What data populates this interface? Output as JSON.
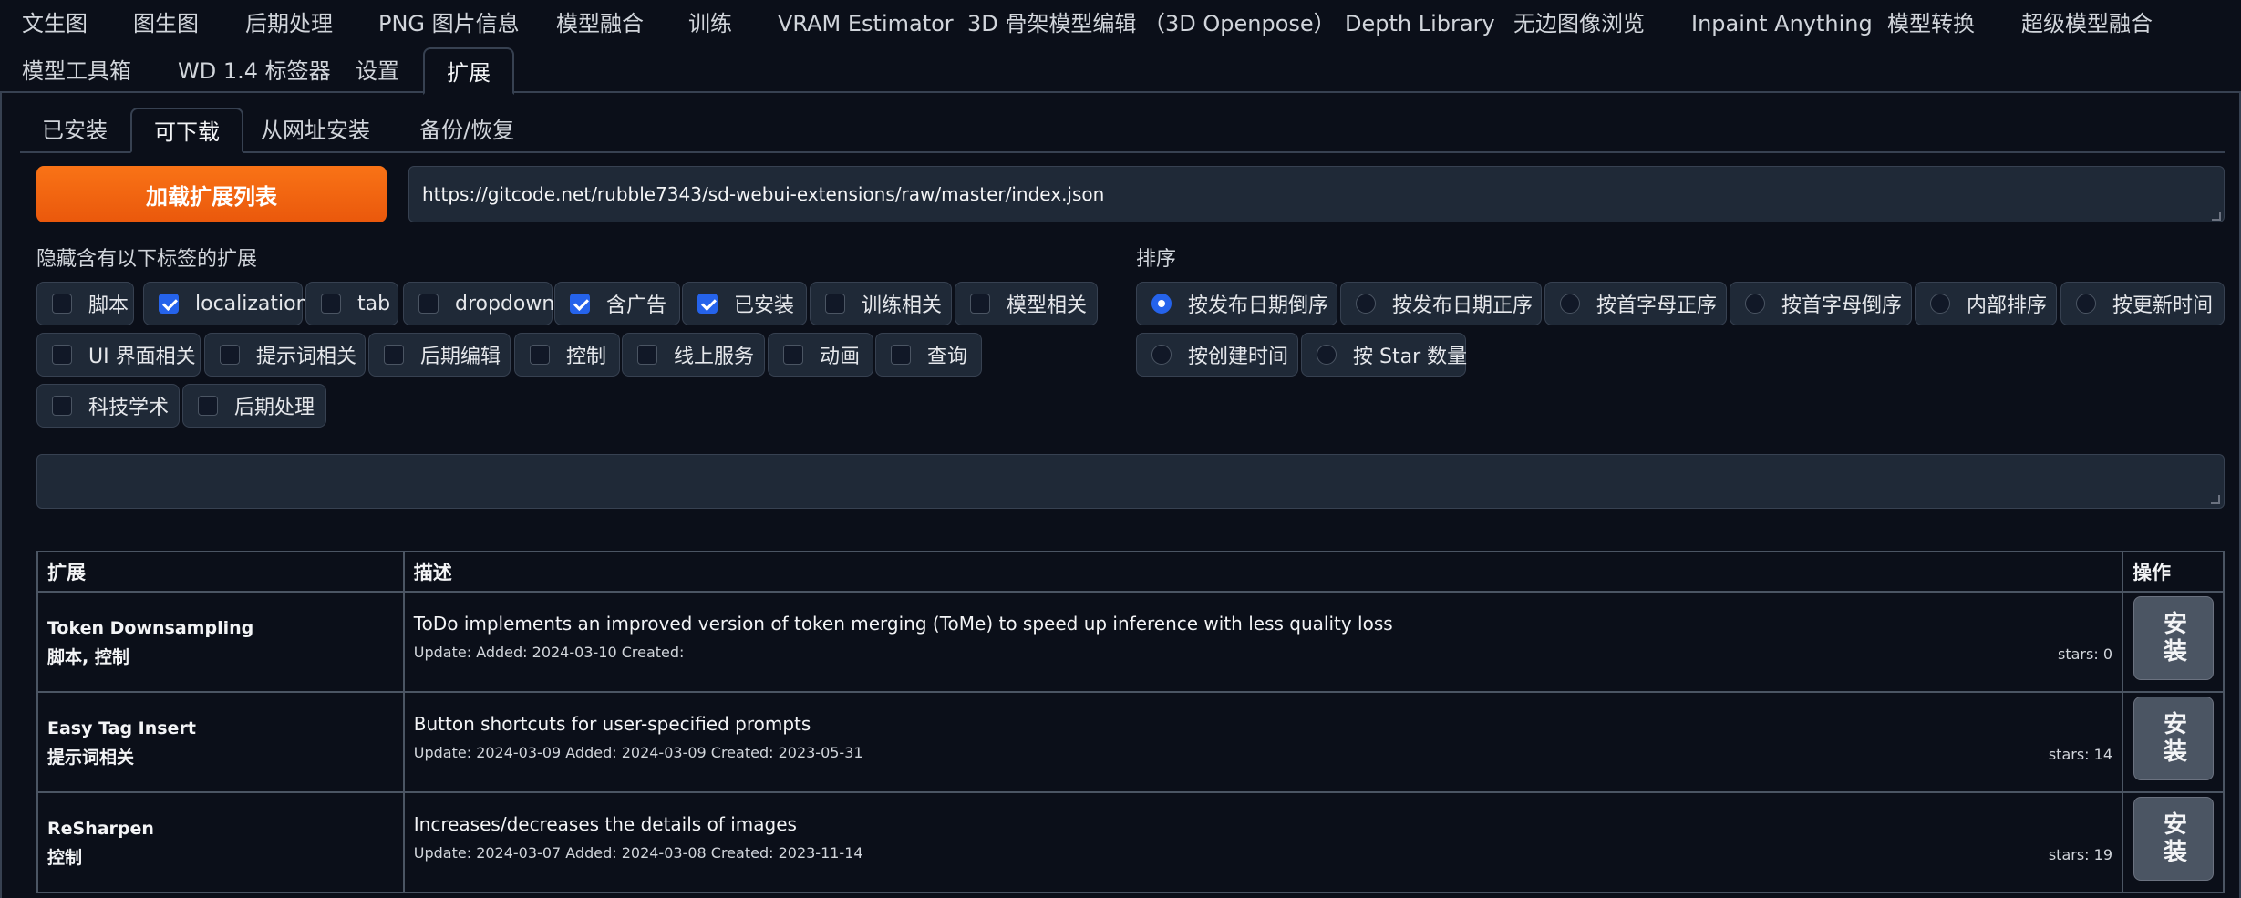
{
  "top_tabs": [
    {
      "label": "文生图"
    },
    {
      "label": "图生图"
    },
    {
      "label": "后期处理"
    },
    {
      "label": "PNG 图片信息"
    },
    {
      "label": "模型融合"
    },
    {
      "label": "训练"
    },
    {
      "label": "VRAM Estimator"
    },
    {
      "label": "3D 骨架模型编辑 （3D Openpose）"
    },
    {
      "label": "Depth Library"
    },
    {
      "label": "无边图像浏览"
    },
    {
      "label": "Inpaint Anything"
    },
    {
      "label": "模型转换"
    },
    {
      "label": "超级模型融合"
    },
    {
      "label": "模型工具箱"
    },
    {
      "label": "WD 1.4 标签器"
    },
    {
      "label": "设置"
    },
    {
      "label": "扩展"
    }
  ],
  "sub_tabs": [
    {
      "label": "已安装"
    },
    {
      "label": "可下载"
    },
    {
      "label": "从网址安装"
    },
    {
      "label": "备份/恢复"
    }
  ],
  "load_button": "加载扩展列表",
  "url_value": "https://gitcode.net/rubble7343/sd-webui-extensions/raw/master/index.json",
  "hide_label": "隐藏含有以下标签的扩展",
  "hide_tags": [
    {
      "label": "脚本",
      "checked": false
    },
    {
      "label": "localization",
      "checked": true
    },
    {
      "label": "tab",
      "checked": false
    },
    {
      "label": "dropdown",
      "checked": false
    },
    {
      "label": "含广告",
      "checked": true
    },
    {
      "label": "已安装",
      "checked": true
    },
    {
      "label": "训练相关",
      "checked": false
    },
    {
      "label": "模型相关",
      "checked": false
    },
    {
      "label": "UI 界面相关",
      "checked": false
    },
    {
      "label": "提示词相关",
      "checked": false
    },
    {
      "label": "后期编辑",
      "checked": false
    },
    {
      "label": "控制",
      "checked": false
    },
    {
      "label": "线上服务",
      "checked": false
    },
    {
      "label": "动画",
      "checked": false
    },
    {
      "label": "查询",
      "checked": false
    },
    {
      "label": "科技学术",
      "checked": false
    },
    {
      "label": "后期处理",
      "checked": false
    }
  ],
  "sort_label": "排序",
  "sort_options": [
    {
      "label": "按发布日期倒序",
      "selected": true
    },
    {
      "label": "按发布日期正序",
      "selected": false
    },
    {
      "label": "按首字母正序",
      "selected": false
    },
    {
      "label": "按首字母倒序",
      "selected": false
    },
    {
      "label": "内部排序",
      "selected": false
    },
    {
      "label": "按更新时间",
      "selected": false
    },
    {
      "label": "按创建时间",
      "selected": false
    },
    {
      "label": "按 Star 数量",
      "selected": false
    }
  ],
  "table": {
    "headers": {
      "extension": "扩展",
      "description": "描述",
      "action": "操作"
    },
    "rows": [
      {
        "name": "Token Downsampling",
        "tags": "脚本, 控制",
        "description": "ToDo implements an improved version of token merging (ToMe) to speed up inference with less quality loss",
        "meta": "Update: Added: 2024-03-10 Created:",
        "stars": "stars: 0",
        "action": "安装"
      },
      {
        "name": "Easy Tag Insert",
        "tags": "提示词相关",
        "description": "Button shortcuts for user-specified prompts",
        "meta": "Update: 2024-03-09 Added: 2024-03-09 Created: 2023-05-31",
        "stars": "stars: 14",
        "action": "安装"
      },
      {
        "name": "ReSharpen",
        "tags": "控制",
        "description": "Increases/decreases the details of images",
        "meta": "Update: 2024-03-07 Added: 2024-03-08 Created: 2023-11-14",
        "stars": "stars: 19",
        "action": "安装"
      }
    ]
  },
  "colors": {
    "background": "#0b0f19",
    "accent_orange": "#f97316",
    "checkbox_blue": "#2563eb",
    "input_bg": "#1f2937"
  }
}
